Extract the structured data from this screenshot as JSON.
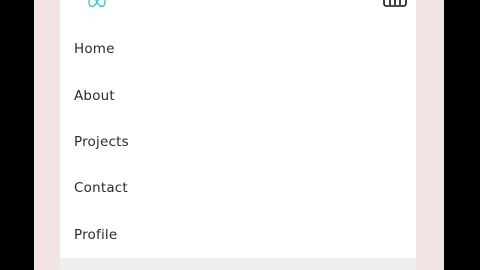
{
  "colors": {
    "accent": "#3fc9c9",
    "page_background": "#f1e4e3",
    "card_background": "#ffffff",
    "text": "#2b2b2b"
  },
  "header": {
    "logo_icon": "infinity-logo-icon",
    "menu_icon": "hamburger-menu-icon"
  },
  "nav": {
    "items": [
      {
        "label": "Home"
      },
      {
        "label": "About"
      },
      {
        "label": "Projects"
      },
      {
        "label": "Contact"
      },
      {
        "label": "Profile"
      }
    ]
  }
}
